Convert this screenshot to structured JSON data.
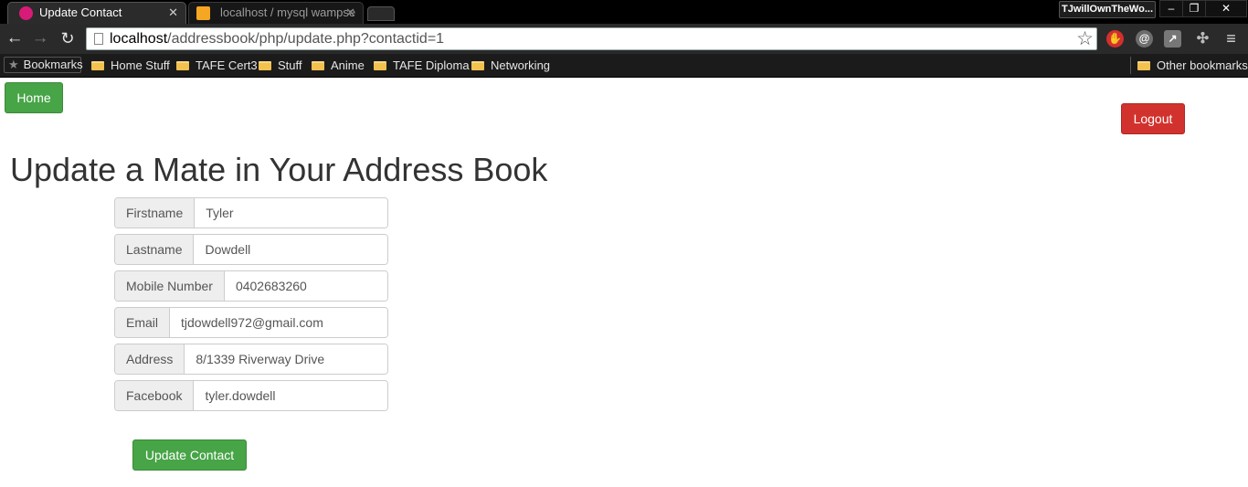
{
  "browser": {
    "tabs": [
      {
        "title": "Update Contact",
        "active": true
      },
      {
        "title": "localhost / mysql wampse",
        "active": false
      }
    ],
    "profile_name": "TJwillOwnTheWo...",
    "window_controls": {
      "minimize": "–",
      "maximize": "❐",
      "close": "✕"
    },
    "nav": {
      "back": "←",
      "forward": "→",
      "reload": "↻"
    },
    "address": {
      "host": "localhost",
      "path": "/addressbook/php/update.php?contactid=1"
    },
    "bookmarks": {
      "apps_label": "Bookmarks",
      "items": [
        "Home Stuff",
        "TAFE Cert3",
        "Stuff",
        "Anime",
        "TAFE Diploma",
        "Networking"
      ],
      "other": "Other bookmarks"
    }
  },
  "page": {
    "home_label": "Home",
    "logout_label": "Logout",
    "title": "Update a Mate in Your Address Book",
    "form": {
      "fields": [
        {
          "label": "Firstname",
          "value": "Tyler"
        },
        {
          "label": "Lastname",
          "value": "Dowdell"
        },
        {
          "label": "Mobile Number",
          "value": "0402683260"
        },
        {
          "label": "Email",
          "value": "tjdowdell972@gmail.com"
        },
        {
          "label": "Address",
          "value": "8/1339 Riverway Drive"
        },
        {
          "label": "Facebook",
          "value": "tyler.dowdell"
        }
      ],
      "submit_label": "Update Contact"
    }
  },
  "colors": {
    "success": "#47a447",
    "danger": "#d2322d",
    "chrome_dark": "#2a2a2a"
  }
}
